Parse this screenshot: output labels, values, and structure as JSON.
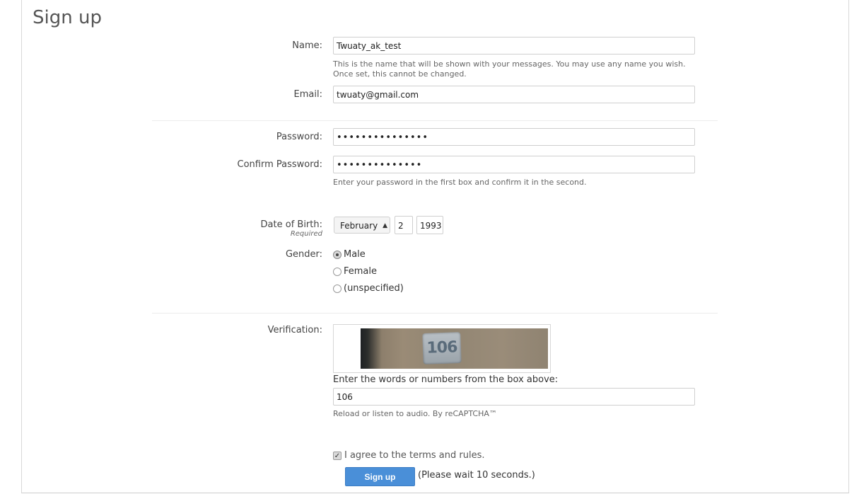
{
  "page": {
    "title": "Sign up"
  },
  "form": {
    "name": {
      "label": "Name:",
      "value": "Twuaty_ak_test",
      "hint": "This is the name that will be shown with your messages. You may use any name you wish. Once set, this cannot be changed."
    },
    "email": {
      "label": "Email:",
      "value": "twuaty@gmail.com"
    },
    "password": {
      "label": "Password:",
      "value": "•••••••••••••••"
    },
    "confirm_password": {
      "label": "Confirm Password:",
      "value": "••••••••••••••",
      "hint": "Enter your password in the first box and confirm it in the second."
    },
    "dob": {
      "label": "Date of Birth:",
      "required": "Required",
      "month": "February",
      "day": "2",
      "year": "1993"
    },
    "gender": {
      "label": "Gender:",
      "options": [
        "Male",
        "Female",
        "(unspecified)"
      ],
      "selected": "Male"
    },
    "verification": {
      "label": "Verification:",
      "captcha_text": "106",
      "prompt": "Enter the words or numbers from the box above:",
      "value": "106",
      "hint": "Reload or listen to audio. By reCAPTCHA™"
    },
    "agree": {
      "prefix": "I agree to the ",
      "link": "terms and rules",
      "suffix": ".",
      "checked": true
    },
    "submit": {
      "label": "Sign up",
      "wait_text": "(Please wait 10 seconds.)"
    }
  },
  "colors": {
    "button": "#4a8fd8",
    "border": "#cfcfcf"
  }
}
